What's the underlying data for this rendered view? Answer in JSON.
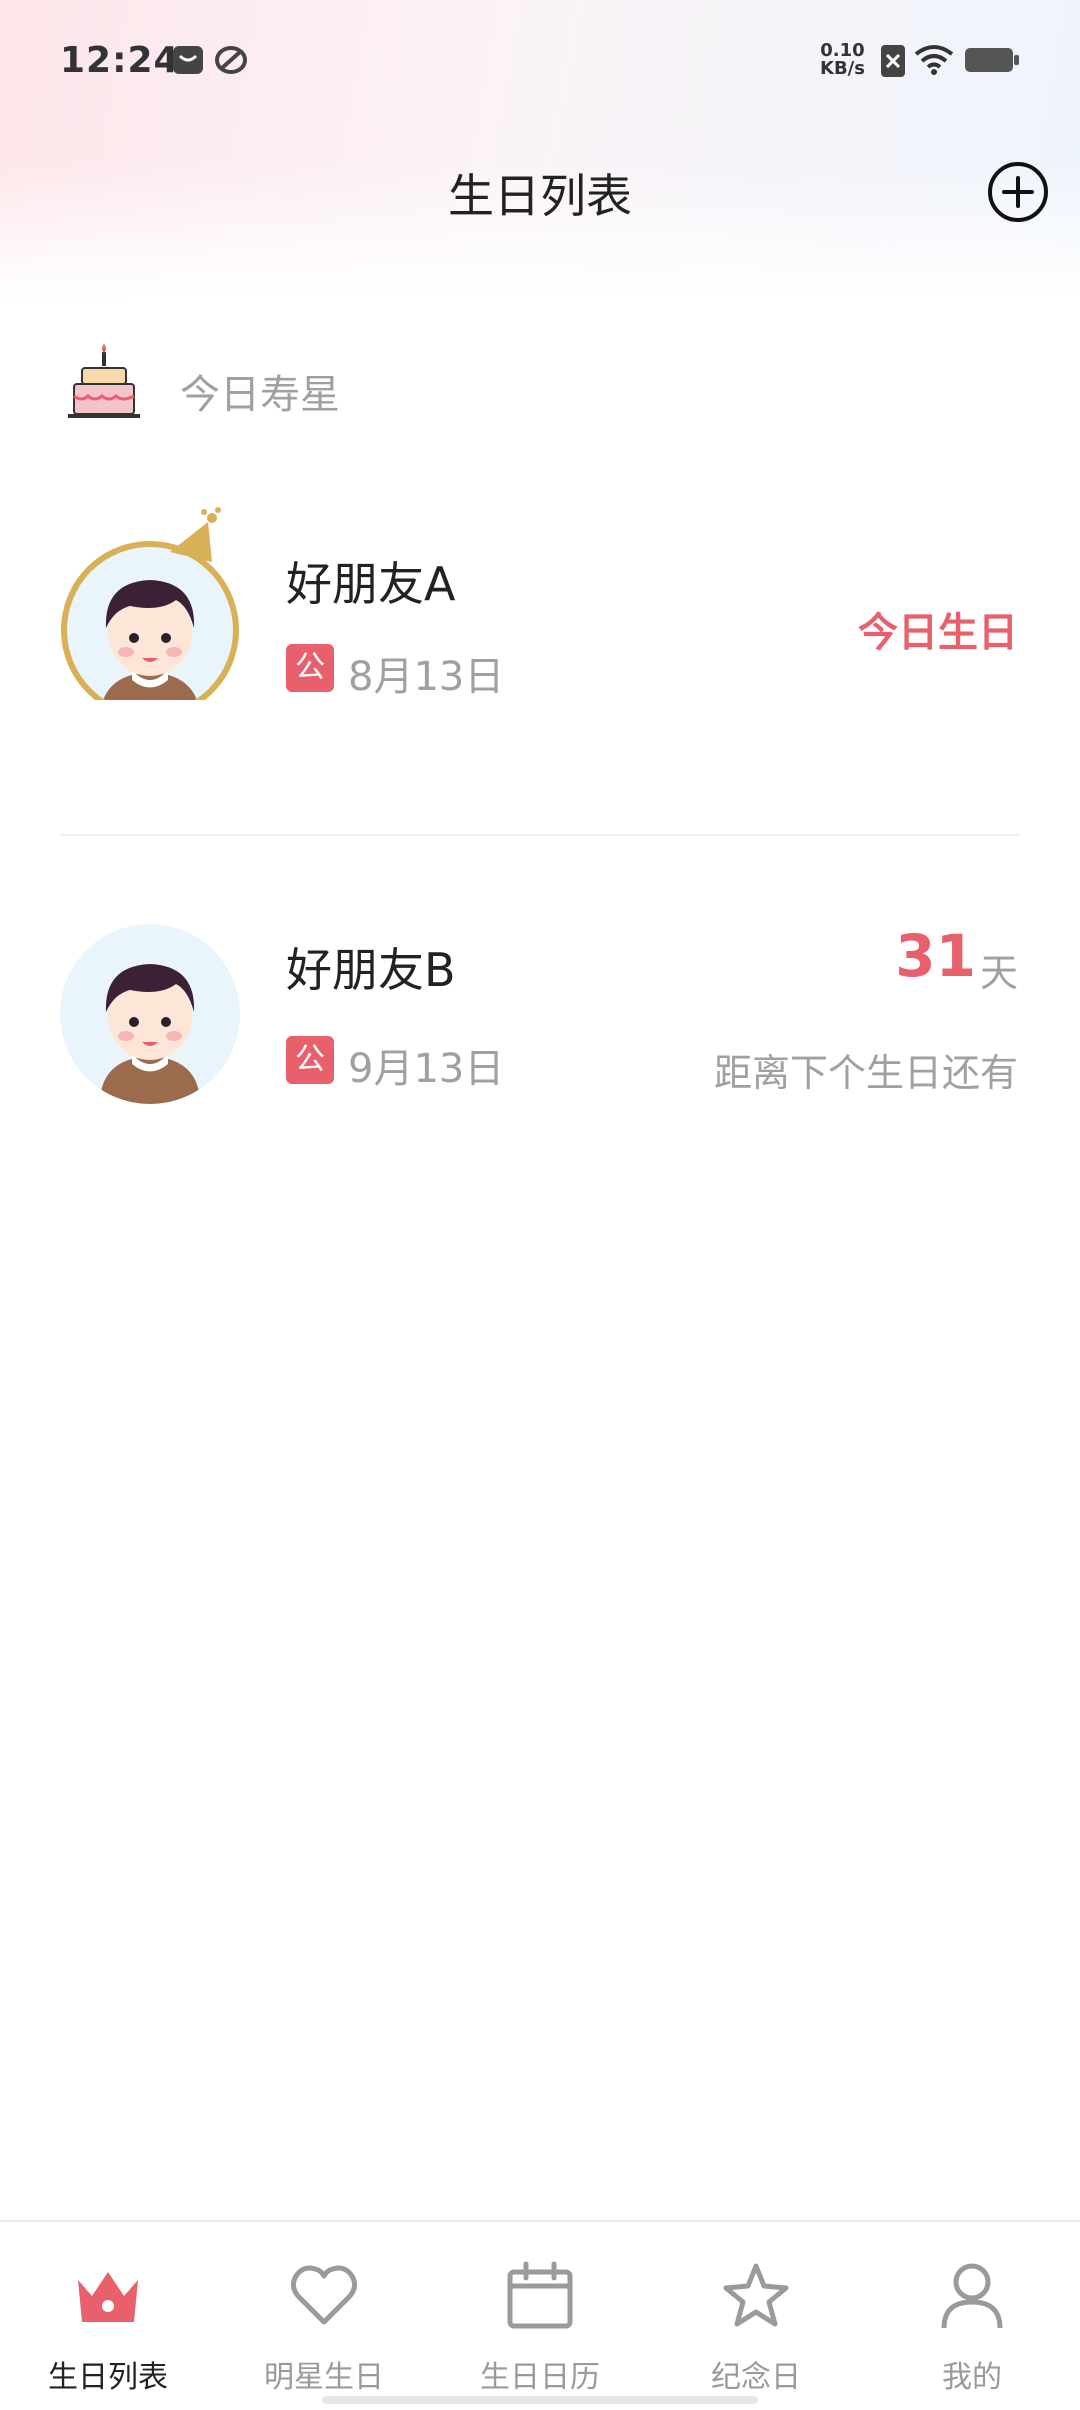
{
  "status_bar": {
    "time": "12:24",
    "net_speed_value": "0.10",
    "net_speed_unit": "KB/s",
    "icons": [
      "mail-icon",
      "app-icon",
      "sim-off-icon",
      "wifi-icon",
      "battery-icon"
    ]
  },
  "header": {
    "title": "生日列表",
    "add_icon": "plus-circle-icon"
  },
  "today_section": {
    "label": "今日寿星",
    "icon": "cake-icon"
  },
  "birthdays": [
    {
      "name": "好朋友A",
      "badge": "公",
      "date": "8月13日",
      "status": "今日生日"
    },
    {
      "name": "好朋友B",
      "badge": "公",
      "date": "9月13日",
      "days": "31",
      "days_unit": "天",
      "countdown_label": "距离下个生日还有"
    }
  ],
  "colors": {
    "accent": "#e9606d",
    "muted_text": "#a0a0a0",
    "avatar_ring": "#d8b055"
  },
  "bottom_nav": {
    "items": [
      {
        "label": "生日列表",
        "icon": "crown-icon",
        "active": true
      },
      {
        "label": "明星生日",
        "icon": "heart-icon",
        "active": false
      },
      {
        "label": "生日日历",
        "icon": "calendar-icon",
        "active": false
      },
      {
        "label": "纪念日",
        "icon": "star-icon",
        "active": false
      },
      {
        "label": "我的",
        "icon": "user-icon",
        "active": false
      }
    ]
  }
}
